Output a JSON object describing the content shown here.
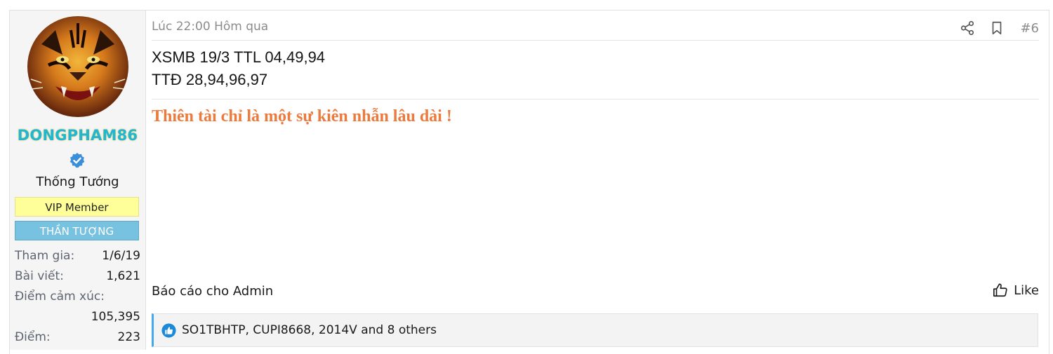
{
  "user": {
    "username": "DONGPHAM86",
    "rank": "Thống Tướng",
    "banners": {
      "vip": "VIP Member",
      "idol": "THẦN TƯỢNG"
    },
    "stats": [
      {
        "label": "Tham gia:",
        "value": "1/6/19"
      },
      {
        "label": "Bài viết:",
        "value": "1,621"
      },
      {
        "label": "Điểm cảm xúc:",
        "value": "105,395"
      },
      {
        "label": "Điểm:",
        "value": "223"
      }
    ]
  },
  "post": {
    "date": "Lúc 22:00 Hôm qua",
    "number": "#6",
    "lines": [
      "XSMB 19/3 TTL 04,49,94",
      "TTĐ 28,94,96,97"
    ],
    "signature": "Thiên tài chỉ là một sự kiên nhẫn lâu dài !"
  },
  "actions": {
    "report": "Báo cáo cho Admin",
    "like": "Like"
  },
  "reactions": {
    "text": "SO1TBHTP, CUPI8668, 2014V and 8 others"
  },
  "colors": {
    "username": "#1fb8d3",
    "signature": "#ed7a3d",
    "vip_banner": "#ffff99",
    "idol_banner": "#76c2e0",
    "reaction_accent": "#47a7eb"
  }
}
